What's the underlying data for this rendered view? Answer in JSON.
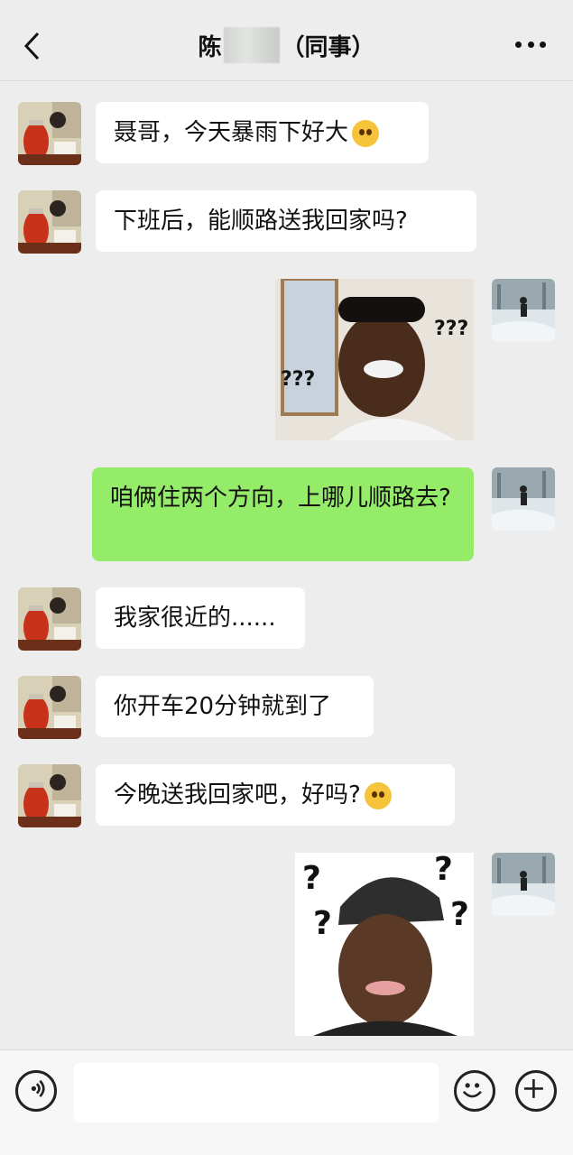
{
  "header": {
    "title_prefix": "陈",
    "title_suffix": "（同事）"
  },
  "messages": [
    {
      "side": "left",
      "text": "聂哥，今天暴雨下好大"
    },
    {
      "side": "left",
      "text": "下班后，能顺路送我回家吗?"
    },
    {
      "side": "right",
      "sticker": "confused-man-sticker",
      "sticker_text": "???"
    },
    {
      "side": "right",
      "text": "咱俩住两个方向，上哪儿顺路去?"
    },
    {
      "side": "left",
      "text": "我家很近的......"
    },
    {
      "side": "left",
      "text": "你开车20分钟就到了"
    },
    {
      "side": "left",
      "text": "今晚送我回家吧，好吗?"
    },
    {
      "side": "right",
      "sticker": "puzzled-man-sticker",
      "sticker_text": "?"
    }
  ],
  "footer": {
    "input_value": ""
  },
  "icons": {
    "back": "chevron-left-icon",
    "more": "more-dots-icon",
    "voice": "voice-icon",
    "emoji": "emoji-icon",
    "plus": "plus-icon"
  },
  "colors": {
    "background": "#ededed",
    "bubble_right": "#95ec69",
    "bubble_left": "#ffffff"
  }
}
